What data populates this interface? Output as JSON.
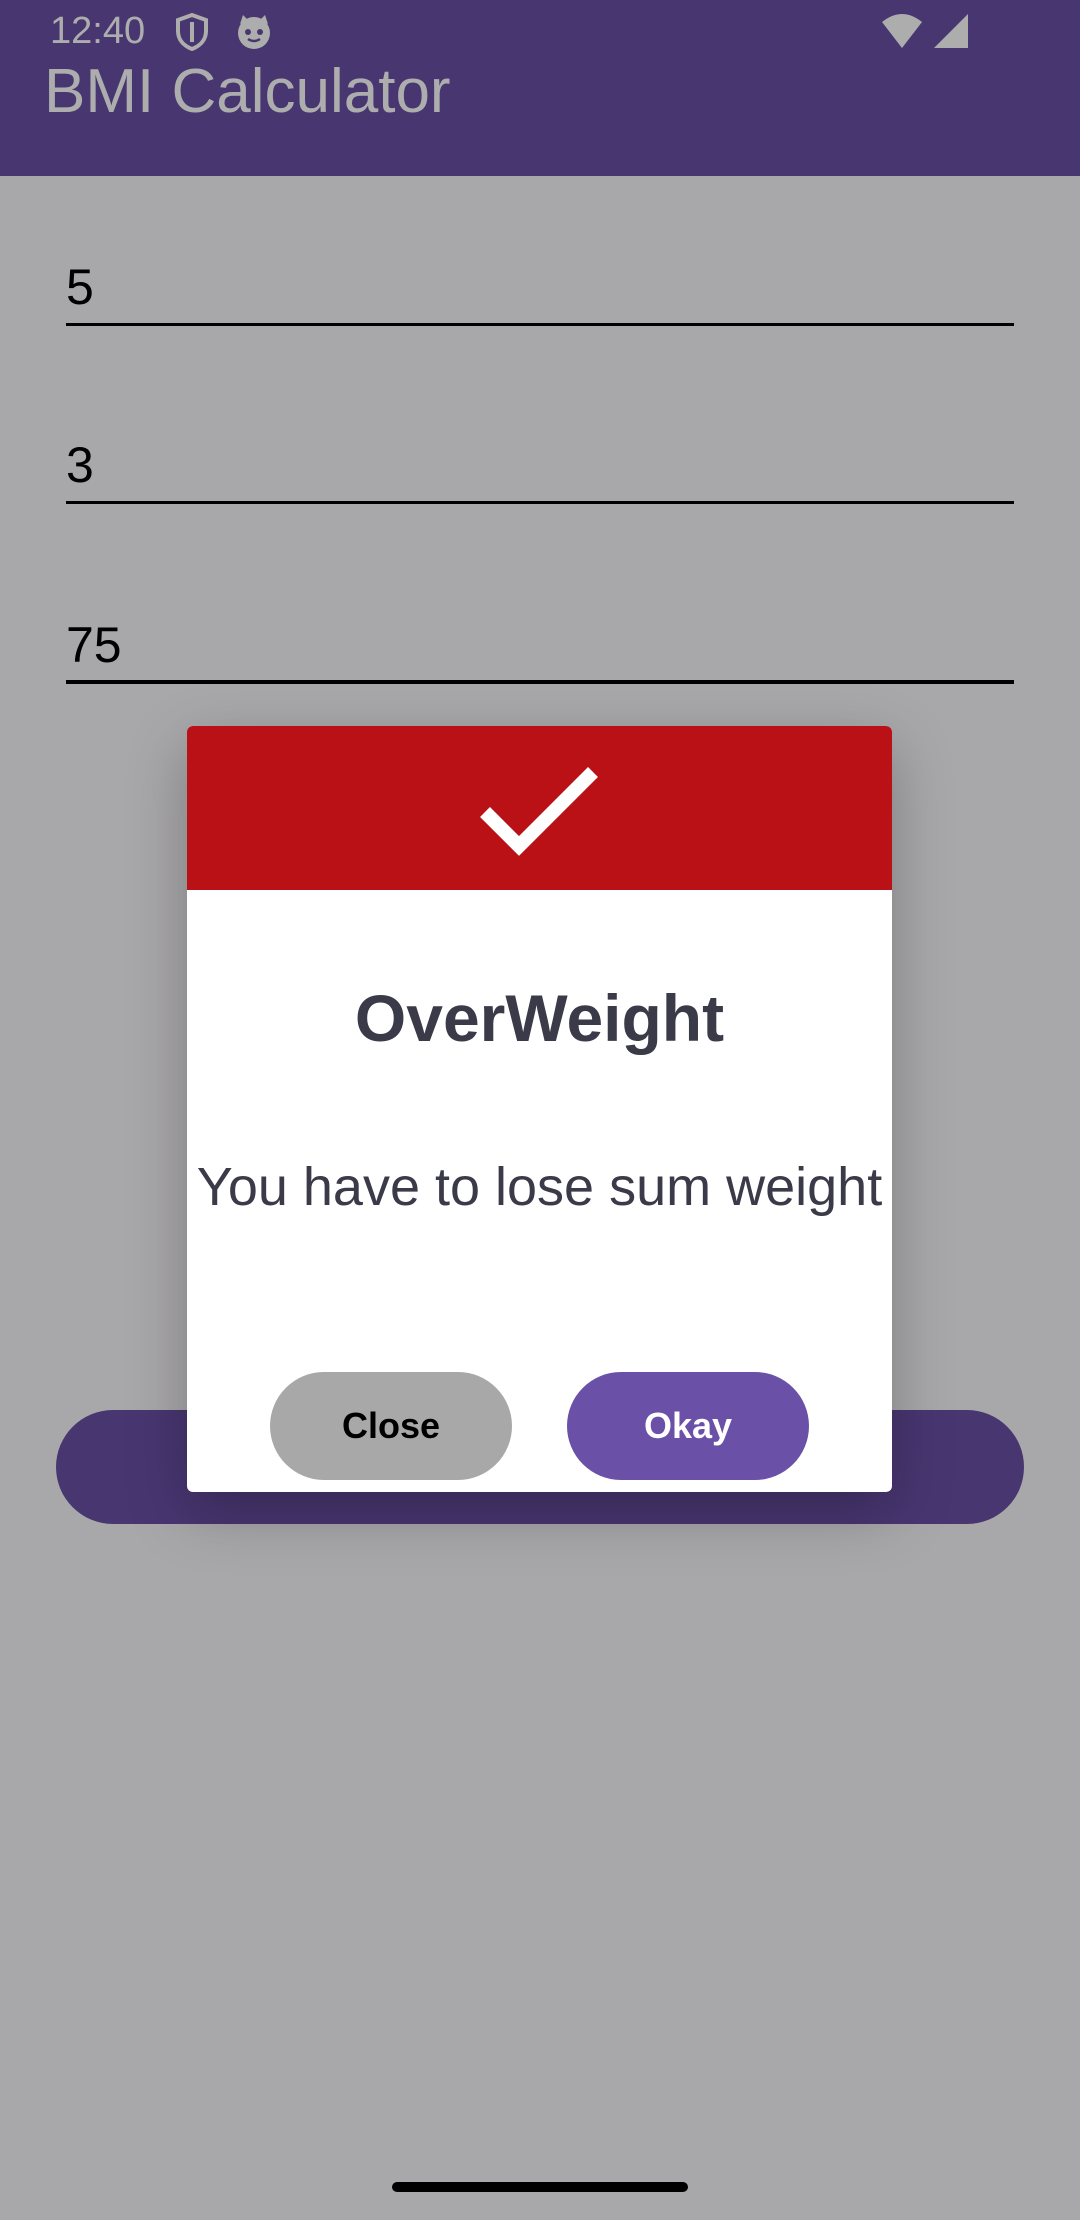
{
  "status_bar": {
    "time": "12:40",
    "icons": [
      "shield-icon",
      "cat-face-icon",
      "wifi-icon",
      "cellular-signal-icon"
    ]
  },
  "app_bar": {
    "title": "BMI Calculator",
    "color": "#6a50a7"
  },
  "form": {
    "height_feet": "5",
    "height_inches": "3",
    "weight": "75"
  },
  "dialog": {
    "header_color": "#b91116",
    "icon": "check-icon",
    "title": "OverWeight",
    "message": "You have to lose sum weight",
    "close_label": "Close",
    "okay_label": "Okay"
  }
}
